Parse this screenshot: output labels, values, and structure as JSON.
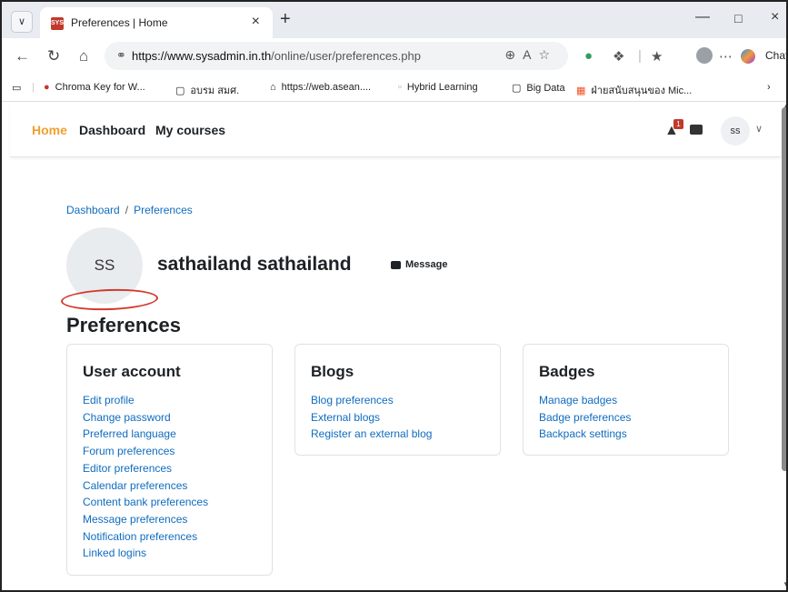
{
  "browser": {
    "tab_title": "Preferences | Home",
    "tab_favicon_text": "SYS",
    "url_domain": "https://www.sysadmin.in.th",
    "url_path": "/online/user/preferences.php",
    "chat_label": "Chat",
    "bookmarks": [
      {
        "label": "Chroma Key for W...",
        "icon": "record-icon"
      },
      {
        "label": "อบรม สมศ.",
        "icon": "folder-icon"
      },
      {
        "label": "https://web.asean....",
        "icon": "home-icon"
      },
      {
        "label": "Hybrid Learning",
        "icon": "page-icon"
      },
      {
        "label": "Big Data",
        "icon": "folder-icon"
      },
      {
        "label": "ฝ่ายสนับสนุนของ Mic...",
        "icon": "microsoft-icon"
      }
    ]
  },
  "navbar": {
    "links": [
      "Home",
      "Dashboard",
      "My courses"
    ],
    "active": "Home",
    "notification_count": "1",
    "user_initials": "ss"
  },
  "breadcrumb": [
    "Dashboard",
    "Preferences"
  ],
  "profile": {
    "initials": "SS",
    "name": "sathailand sathailand",
    "message_label": "Message"
  },
  "page_heading": "Preferences",
  "cards": [
    {
      "title": "User account",
      "links": [
        "Edit profile",
        "Change password",
        "Preferred language",
        "Forum preferences",
        "Editor preferences",
        "Calendar preferences",
        "Content bank preferences",
        "Message preferences",
        "Notification preferences",
        "Linked logins"
      ]
    },
    {
      "title": "Blogs",
      "links": [
        "Blog preferences",
        "External blogs",
        "Register an external blog"
      ]
    },
    {
      "title": "Badges",
      "links": [
        "Manage badges",
        "Badge preferences",
        "Backpack settings"
      ]
    }
  ],
  "colors": {
    "accent": "#f0a030",
    "link": "#0f6cbf",
    "annotation": "#d23a2c"
  }
}
